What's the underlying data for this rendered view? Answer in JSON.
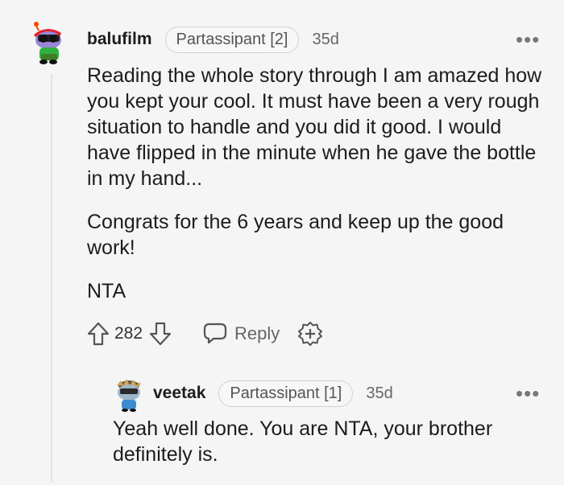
{
  "comment": {
    "username": "balufilm",
    "flair": "Partassipant [2]",
    "time": "35d",
    "paragraphs": [
      "Reading the whole story through I am amazed how you kept your cool. It must have been a very rough situation to handle and you did it good. I would have flipped in the minute when he gave the bottle in my hand...",
      "Congrats for the 6 years and keep up the good work!",
      "NTA"
    ],
    "score": "282",
    "reply_label": "Reply",
    "avatar_icon": "snoo-avatar-icon"
  },
  "reply": {
    "username": "veetak",
    "flair": "Partassipant [1]",
    "time": "35d",
    "text": "Yeah well done. You are NTA, your brother definitely is.",
    "avatar_icon": "snoo-avatar-icon"
  },
  "more_label": "•••"
}
